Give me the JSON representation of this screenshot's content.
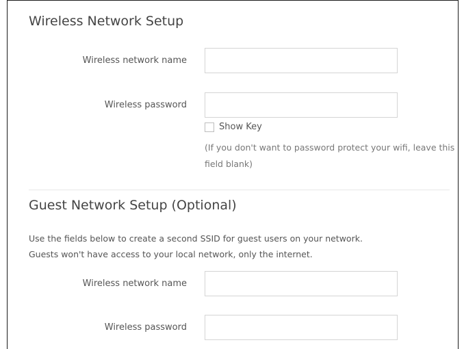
{
  "wireless_setup": {
    "title": "Wireless Network Setup",
    "network_name_label": "Wireless network name",
    "network_name_value": "",
    "password_label": "Wireless password",
    "password_value": "",
    "show_key_label": "Show Key",
    "show_key_checked": false,
    "help_text": "(If you don't want to password protect your wifi, leave this field blank)"
  },
  "guest_setup": {
    "title": "Guest Network Setup (Optional)",
    "description_line1": "Use the fields below to create a second SSID for guest users on your network.",
    "description_line2": "Guests won't have access to your local network, only the internet.",
    "network_name_label": "Wireless network name",
    "network_name_value": "",
    "password_label": "Wireless password",
    "password_value": ""
  }
}
